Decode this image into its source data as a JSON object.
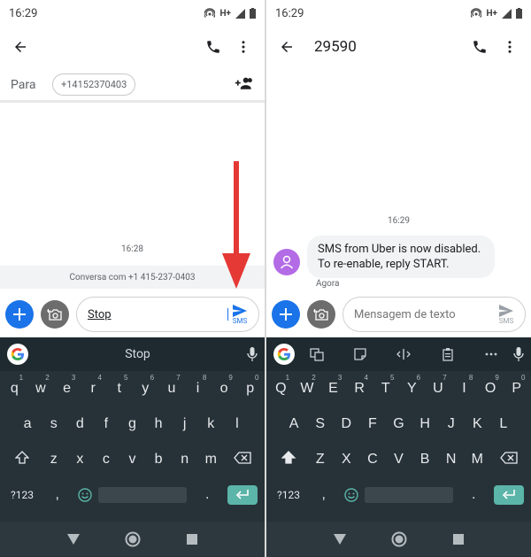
{
  "left": {
    "status": {
      "time": "16:29",
      "network": "H+"
    },
    "appbar": {
      "title": ""
    },
    "to": {
      "label": "Para",
      "chip": "+14152370403"
    },
    "timestamp": "16:28",
    "conversation_notice": "Conversa com +1 415-237-0403",
    "compose": {
      "value": "Stop",
      "send_label": "SMS"
    },
    "keyboard": {
      "suggestion": "Stop",
      "row1": [
        "q",
        "w",
        "e",
        "r",
        "t",
        "y",
        "u",
        "i",
        "o",
        "p"
      ],
      "row1_sup": [
        "1",
        "2",
        "3",
        "4",
        "5",
        "6",
        "7",
        "8",
        "9",
        "0"
      ],
      "row2": [
        "a",
        "s",
        "d",
        "f",
        "g",
        "h",
        "j",
        "k",
        "l"
      ],
      "row3": [
        "z",
        "x",
        "c",
        "v",
        "b",
        "n",
        "m"
      ],
      "sym_label": "?123",
      "comma": ",",
      "period": "."
    }
  },
  "right": {
    "status": {
      "time": "16:29",
      "network": "H+"
    },
    "appbar": {
      "title": "29590"
    },
    "timestamp": "16:29",
    "message": {
      "line1": "SMS from Uber is now disabled.",
      "line2": "To re-enable, reply START.",
      "time": "Agora"
    },
    "compose": {
      "placeholder": "Mensagem de texto",
      "send_label": "SMS"
    },
    "keyboard": {
      "row1": [
        "Q",
        "W",
        "E",
        "R",
        "T",
        "Y",
        "U",
        "I",
        "O",
        "P"
      ],
      "row1_sup": [
        "1",
        "2",
        "3",
        "4",
        "5",
        "6",
        "7",
        "8",
        "9",
        "0"
      ],
      "row2": [
        "A",
        "S",
        "D",
        "F",
        "G",
        "H",
        "J",
        "K",
        "L"
      ],
      "row3": [
        "Z",
        "X",
        "C",
        "V",
        "B",
        "N",
        "M"
      ],
      "sym_label": "?123",
      "comma": ",",
      "period": "."
    }
  },
  "colors": {
    "accent": "#1a73e8",
    "avatar": "#b36be6",
    "arrow": "#e53935",
    "keyboard_bg": "#263238",
    "enter_key": "#5bb5a8"
  }
}
